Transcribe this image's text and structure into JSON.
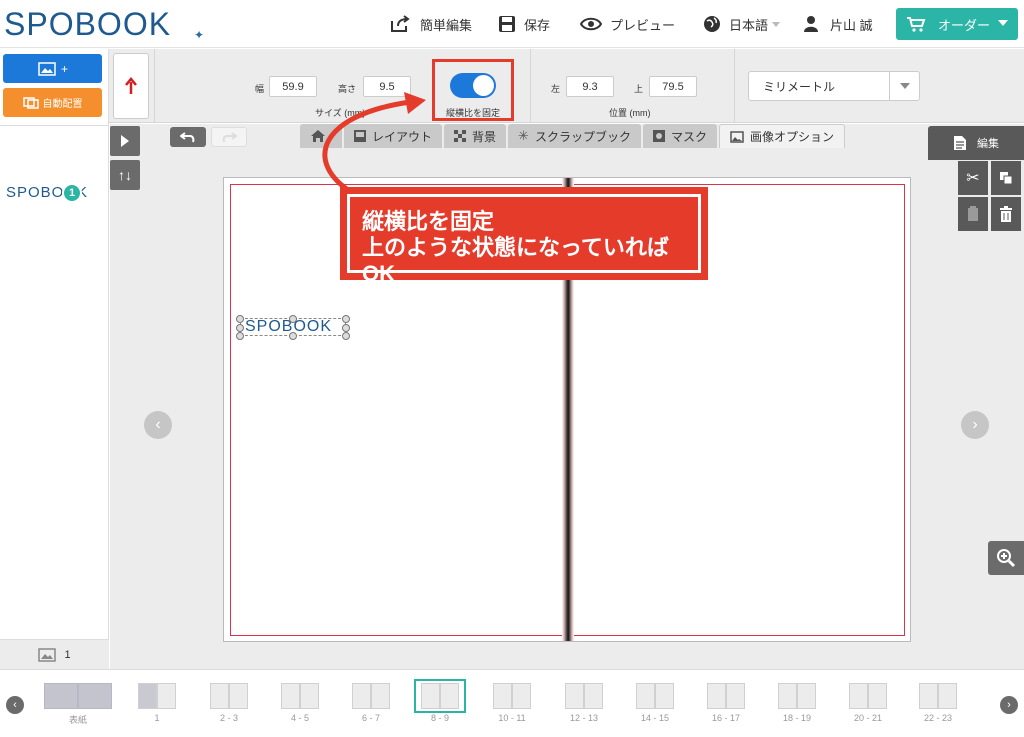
{
  "header": {
    "logo_text": "SPOBOOK",
    "simple_edit": "簡単編集",
    "save": "保存",
    "preview": "プレビュー",
    "language": "日本語",
    "user": "片山 誠",
    "order": "オーダー"
  },
  "left_panel": {
    "add_photo": "+",
    "auto_layout": "自動配置",
    "thumb_text": "SPOBOOK",
    "thumb_badge": "1",
    "photo_count": "1"
  },
  "toolbar": {
    "width_label": "幅",
    "width_value": "59.9",
    "height_label": "高さ",
    "height_value": "9.5",
    "size_caption": "サイズ (mm)",
    "aspect_lock_label": "縦横比を固定",
    "aspect_lock_on": true,
    "left_label": "左",
    "left_value": "9.3",
    "top_label": "上",
    "top_value": "79.5",
    "position_caption": "位置 (mm)",
    "unit": "ミリメートル"
  },
  "tabs": {
    "layout": "レイアウト",
    "background": "背景",
    "scrapbook": "スクラップブック",
    "mask": "マスク",
    "image_options": "画像オプション"
  },
  "edit_panel": {
    "title": "編集"
  },
  "canvas": {
    "selected_text": "SPOBOOK"
  },
  "callout": {
    "text": "縦横比を固定\n上のような状態になっていればOK"
  },
  "pages": [
    {
      "label": "表紙",
      "type": "cover"
    },
    {
      "label": "1",
      "type": "single"
    },
    {
      "label": "2 - 3",
      "type": "spread"
    },
    {
      "label": "4 - 5",
      "type": "spread"
    },
    {
      "label": "6 - 7",
      "type": "spread"
    },
    {
      "label": "8 - 9",
      "type": "spread",
      "active": true
    },
    {
      "label": "10 - 11",
      "type": "spread"
    },
    {
      "label": "12 - 13",
      "type": "spread"
    },
    {
      "label": "14 - 15",
      "type": "spread"
    },
    {
      "label": "16 - 17",
      "type": "spread"
    },
    {
      "label": "18 - 19",
      "type": "spread"
    },
    {
      "label": "20 - 21",
      "type": "spread"
    },
    {
      "label": "22 - 23",
      "type": "spread"
    }
  ],
  "colors": {
    "accent_teal": "#2ab5a6",
    "primary_blue": "#1d79d9",
    "orange": "#f58f2e",
    "annotation_red": "#e53b2b"
  }
}
